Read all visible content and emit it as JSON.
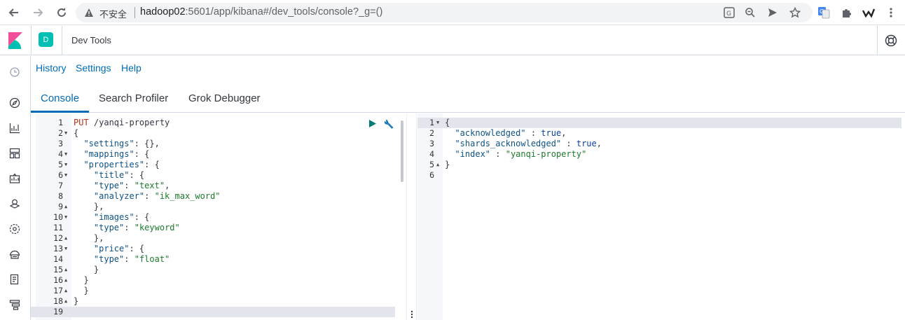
{
  "browser": {
    "insecure_label": "不安全",
    "url_host": "hadoop02",
    "url_rest": ":5601/app/kibana#/dev_tools/console?_g=()"
  },
  "header": {
    "space_initial": "D",
    "app_title": "Dev Tools"
  },
  "menu": {
    "history": "History",
    "settings": "Settings",
    "help": "Help"
  },
  "tabs": [
    "Console",
    "Search Profiler",
    "Grok Debugger"
  ],
  "colors": {
    "accent": "#006bb4",
    "space_badge": "#00bfb3",
    "run_button": "#017d73"
  },
  "request_editor": {
    "lines": [
      {
        "n": "1",
        "fold": "",
        "text": "PUT /yanqi-property"
      },
      {
        "n": "2",
        "fold": "down",
        "text": "{"
      },
      {
        "n": "3",
        "fold": "",
        "text": "  \"settings\": {},"
      },
      {
        "n": "4",
        "fold": "down",
        "text": "  \"mappings\": {"
      },
      {
        "n": "5",
        "fold": "down",
        "text": "  \"properties\": {"
      },
      {
        "n": "6",
        "fold": "down",
        "text": "    \"title\": {"
      },
      {
        "n": "7",
        "fold": "",
        "text": "    \"type\": \"text\","
      },
      {
        "n": "8",
        "fold": "",
        "text": "    \"analyzer\": \"ik_max_word\""
      },
      {
        "n": "9",
        "fold": "up",
        "text": "    },"
      },
      {
        "n": "10",
        "fold": "down",
        "text": "    \"images\": {"
      },
      {
        "n": "11",
        "fold": "",
        "text": "    \"type\": \"keyword\""
      },
      {
        "n": "12",
        "fold": "up",
        "text": "    },"
      },
      {
        "n": "13",
        "fold": "down",
        "text": "    \"price\": {"
      },
      {
        "n": "14",
        "fold": "",
        "text": "    \"type\": \"float\""
      },
      {
        "n": "15",
        "fold": "up",
        "text": "    }"
      },
      {
        "n": "16",
        "fold": "up",
        "text": "  }"
      },
      {
        "n": "17",
        "fold": "up",
        "text": "  }"
      },
      {
        "n": "18",
        "fold": "up",
        "text": "}"
      },
      {
        "n": "19",
        "fold": "",
        "text": ""
      }
    ]
  },
  "response_editor": {
    "lines": [
      {
        "n": "1",
        "fold": "down",
        "text": "{"
      },
      {
        "n": "2",
        "fold": "",
        "text": "  \"acknowledged\" : true,"
      },
      {
        "n": "3",
        "fold": "",
        "text": "  \"shards_acknowledged\" : true,"
      },
      {
        "n": "4",
        "fold": "",
        "text": "  \"index\" : \"yanqi-property\""
      },
      {
        "n": "5",
        "fold": "up",
        "text": "}"
      },
      {
        "n": "6",
        "fold": "",
        "text": ""
      }
    ]
  }
}
